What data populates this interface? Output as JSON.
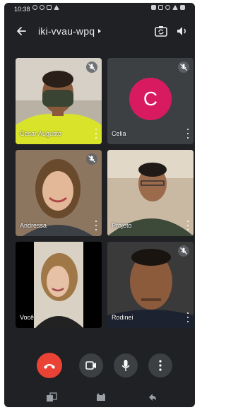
{
  "status_bar": {
    "time": "10:38"
  },
  "header": {
    "meeting_code": "iki-vvau-wpq",
    "icons": [
      "back-arrow-icon",
      "switch-camera-icon",
      "speaker-icon"
    ]
  },
  "participants": [
    {
      "name": "Cesar Augusto",
      "muted": true
    },
    {
      "name": "Celia",
      "muted": true,
      "avatar_letter": "C",
      "avatar_color": "#d81b60"
    },
    {
      "name": "Andressa",
      "muted": true
    },
    {
      "name": "Projeto",
      "muted": false
    },
    {
      "name": "Você",
      "muted": false
    },
    {
      "name": "Rodinei",
      "muted": true
    }
  ],
  "controls": [
    "end-call-icon",
    "camera-icon",
    "microphone-icon",
    "more-options-icon"
  ],
  "colors": {
    "background": "#202124",
    "end_call": "#ea4335",
    "button": "#3c4043",
    "avatar": "#d81b60"
  }
}
